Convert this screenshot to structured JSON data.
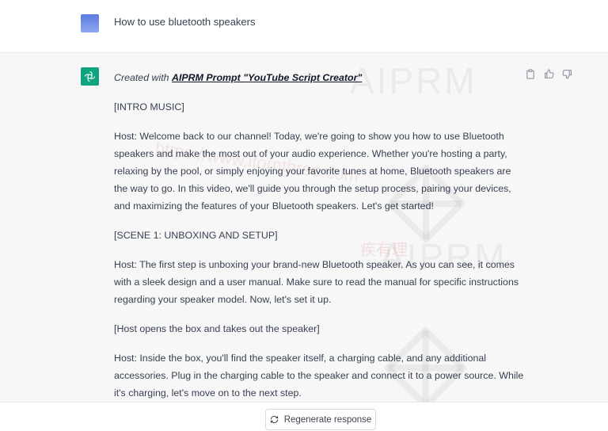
{
  "user_message": {
    "text": "How to use bluetooth speakers"
  },
  "assistant_message": {
    "credit_prefix": "Created with ",
    "credit_link": "AIPRM Prompt \"YouTube Script Creator\"",
    "paragraphs": [
      "[INTRO MUSIC]",
      "Host: Welcome back to our channel! Today, we're going to show you how to use Bluetooth speakers and make the most out of your audio experience. Whether you're hosting a party, relaxing by the pool, or simply enjoying your favorite tunes at home, Bluetooth speakers are the way to go. In this video, we'll guide you through the setup process, pairing your devices, and maximizing the features of your Bluetooth speakers. Let's get started!",
      "[SCENE 1: UNBOXING AND SETUP]",
      "Host: The first step is unboxing your brand-new Bluetooth speaker. As you can see, it comes with a sleek design and a user manual. Make sure to read the manual for specific instructions regarding your speaker model. Now, let's set it up.",
      "[Host opens the box and takes out the speaker]",
      "Host: Inside the box, you'll find the speaker itself, a charging cable, and any additional accessories. Plug in the charging cable to the speaker and connect it to a power source. While it's charging, let's move on to the next step."
    ]
  },
  "watermarks": {
    "aiprm_top": "AIPRM",
    "aiprm_mid": "AIPRM",
    "site_url": "https://www.ifornthree.com",
    "site_cn": "疾有理"
  },
  "actions": {
    "icons": [
      "clipboard-icon",
      "thumbs-up-icon",
      "thumbs-down-icon"
    ]
  },
  "bottom": {
    "regenerate_label": "Regenerate response"
  },
  "colors": {
    "assistant_bg": "#f7f7f8",
    "gpt_green": "#10a37f",
    "user_avatar": "#6b86e6"
  }
}
